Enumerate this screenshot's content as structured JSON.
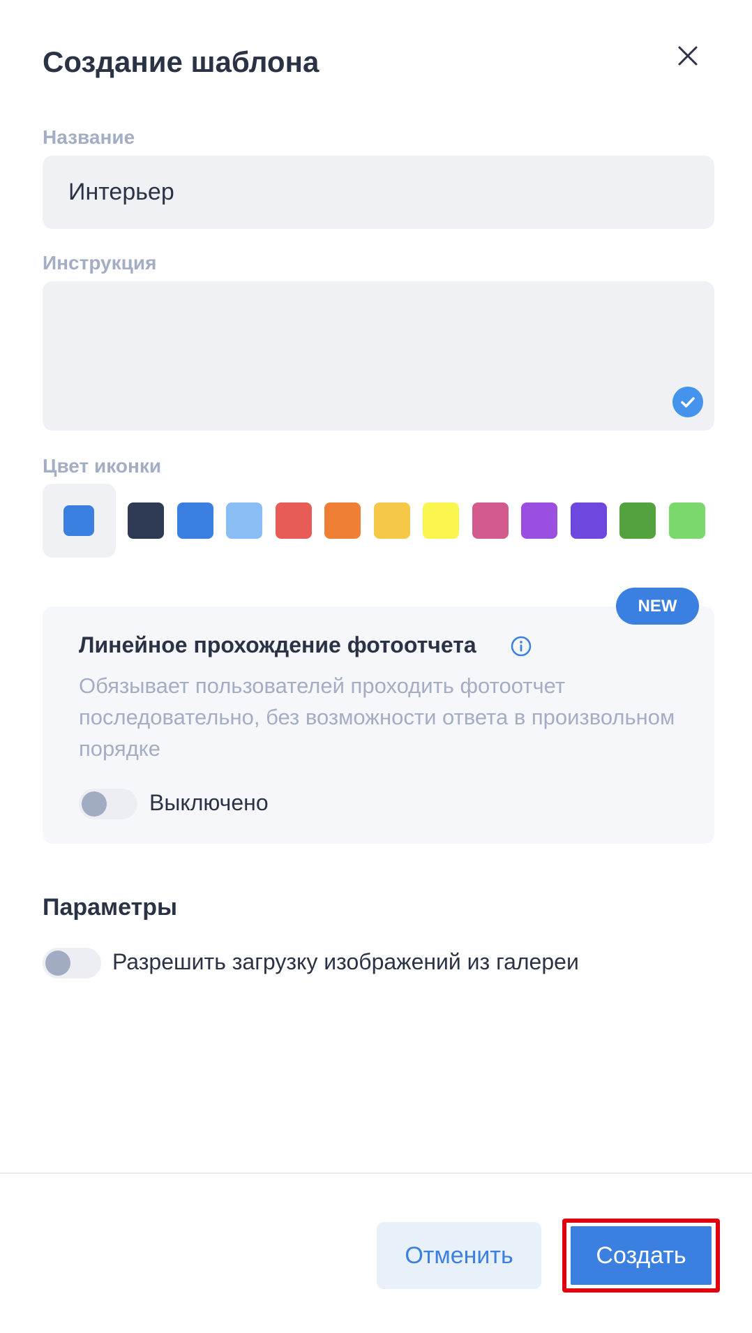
{
  "dialog": {
    "title": "Создание шаблона"
  },
  "fields": {
    "name_label": "Название",
    "name_value": "Интерьер",
    "instruction_label": "Инструкция",
    "instruction_value": "",
    "icon_color_label": "Цвет иконки"
  },
  "colors": {
    "selected": "#3b80e0",
    "swatches": [
      "#2f3a55",
      "#3b80e0",
      "#8bbdf5",
      "#e85c58",
      "#ee7f35",
      "#f5c947",
      "#fbf64f",
      "#d35a8c",
      "#9b4fe0",
      "#6e48de",
      "#53a23f",
      "#7ad86d"
    ]
  },
  "linear_card": {
    "badge": "NEW",
    "title": "Линейное прохождение фотоотчета",
    "description": "Обязывает пользователей проходить фотоотчет последовательно, без возможности ответа в произвольном порядке",
    "toggle_label": "Выключено",
    "toggle_on": false
  },
  "params": {
    "title": "Параметры",
    "gallery_label": "Разрешить загрузку изображений из галереи",
    "gallery_on": false
  },
  "footer": {
    "cancel_label": "Отменить",
    "create_label": "Создать"
  }
}
